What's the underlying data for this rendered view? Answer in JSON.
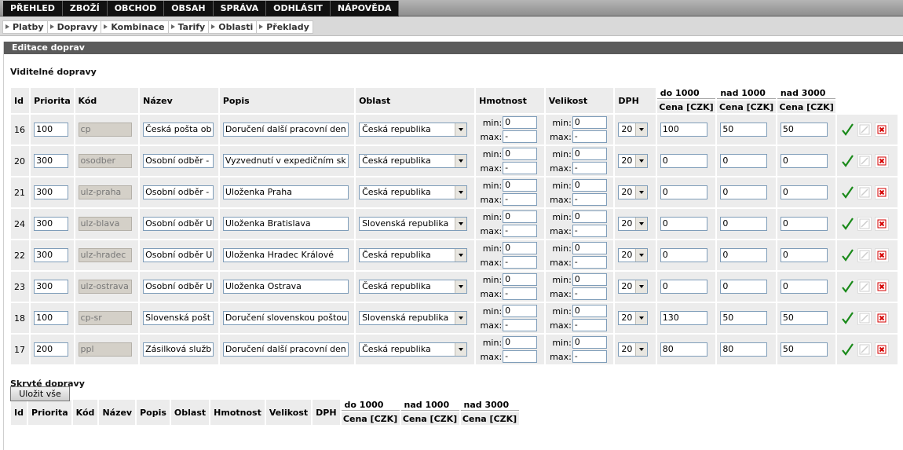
{
  "top_menu": [
    "PŘEHLED",
    "ZBOŽÍ",
    "OBCHOD",
    "OBSAH",
    "SPRÁVA",
    "ODHLÁSIT",
    "NÁPOVĚDA"
  ],
  "sub_menu": [
    "Platby",
    "Dopravy",
    "Kombinace",
    "Tarify",
    "Oblasti",
    "Překlady"
  ],
  "panel_title": "Editace doprav",
  "visible_section": "Viditelné dopravy",
  "hidden_section": "Skryté dopravy",
  "columns": {
    "id": "Id",
    "priority": "Priorita",
    "code": "Kód",
    "name": "Název",
    "desc": "Popis",
    "region": "Oblast",
    "weight": "Hmotnost",
    "size": "Velikost",
    "vat": "DPH",
    "grp1": "do 1000",
    "grp2": "nad 1000",
    "grp3": "nad 3000",
    "price": "Cena [CZK]"
  },
  "labels": {
    "min": "min:",
    "max": "max:"
  },
  "rows": [
    {
      "id": "16",
      "priority": "100",
      "code": "cp",
      "name": "Česká pošta ob",
      "desc": "Doručení další pracovní den",
      "region": "Česká republika",
      "w_min": "0",
      "w_max": "-",
      "s_min": "0",
      "s_max": "-",
      "vat": "20",
      "p1": "100",
      "p2": "50",
      "p3": "50"
    },
    {
      "id": "20",
      "priority": "300",
      "code": "osodber",
      "name": "Osobní odběr -",
      "desc": "Vyzvednutí v expedičním sk",
      "region": "Česká republika",
      "w_min": "0",
      "w_max": "-",
      "s_min": "0",
      "s_max": "-",
      "vat": "20",
      "p1": "0",
      "p2": "0",
      "p3": "0"
    },
    {
      "id": "21",
      "priority": "300",
      "code": "ulz-praha",
      "name": "Osobní odběr -",
      "desc": "Uloženka Praha",
      "region": "Česká republika",
      "w_min": "0",
      "w_max": "-",
      "s_min": "0",
      "s_max": "-",
      "vat": "20",
      "p1": "0",
      "p2": "0",
      "p3": "0"
    },
    {
      "id": "24",
      "priority": "300",
      "code": "ulz-blava",
      "name": "Osobní odběr U",
      "desc": "Uloženka Bratislava",
      "region": "Slovenská republika",
      "w_min": "0",
      "w_max": "-",
      "s_min": "0",
      "s_max": "-",
      "vat": "20",
      "p1": "0",
      "p2": "0",
      "p3": "0"
    },
    {
      "id": "22",
      "priority": "300",
      "code": "ulz-hradec",
      "name": "Osobní odběr U",
      "desc": "Uloženka Hradec Králové",
      "region": "Česká republika",
      "w_min": "0",
      "w_max": "-",
      "s_min": "0",
      "s_max": "-",
      "vat": "20",
      "p1": "0",
      "p2": "0",
      "p3": "0"
    },
    {
      "id": "23",
      "priority": "300",
      "code": "ulz-ostrava",
      "name": "Osobní odběr U",
      "desc": "Uloženka Ostrava",
      "region": "Česká republika",
      "w_min": "0",
      "w_max": "-",
      "s_min": "0",
      "s_max": "-",
      "vat": "20",
      "p1": "0",
      "p2": "0",
      "p3": "0"
    },
    {
      "id": "18",
      "priority": "100",
      "code": "cp-sr",
      "name": "Slovenská pošt",
      "desc": "Doručení slovenskou poštou",
      "region": "Slovenská republika",
      "w_min": "0",
      "w_max": "-",
      "s_min": "0",
      "s_max": "-",
      "vat": "20",
      "p1": "130",
      "p2": "50",
      "p3": "50"
    },
    {
      "id": "17",
      "priority": "200",
      "code": "ppl",
      "name": "Zásilková služb",
      "desc": "Doručení další pracovní den",
      "region": "Česká republika",
      "w_min": "0",
      "w_max": "-",
      "s_min": "0",
      "s_max": "-",
      "vat": "20",
      "p1": "80",
      "p2": "80",
      "p3": "50"
    }
  ],
  "save_label": "Uložit vše",
  "icons": {
    "confirm": "check-icon",
    "edit": "pencil-icon",
    "delete": "delete-icon"
  },
  "colors": {
    "menu_bg": "#111111",
    "panel_title_bg": "#5b5b5b",
    "check": "#1a8a1a",
    "delete": "#d40000"
  }
}
